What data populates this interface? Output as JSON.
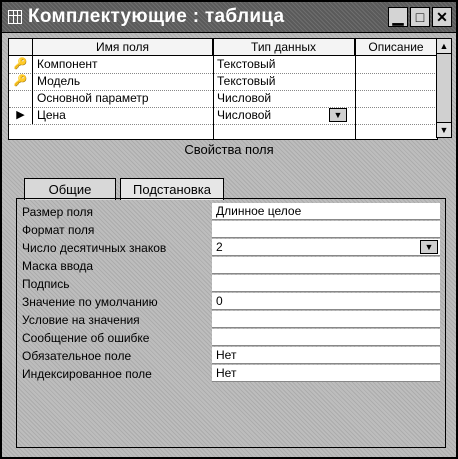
{
  "window": {
    "title": "Комплектующие : таблица"
  },
  "design_grid": {
    "columns": [
      "Имя поля",
      "Тип данных",
      "Описание"
    ],
    "rows": [
      {
        "marker": "key",
        "field": "Компонент",
        "type": "Текстовый"
      },
      {
        "marker": "key",
        "field": "Модель",
        "type": "Текстовый"
      },
      {
        "marker": "",
        "field": "Основной параметр",
        "type": "Числовой"
      },
      {
        "marker": "current",
        "field": "Цена",
        "type": "Числовой"
      }
    ]
  },
  "properties": {
    "title": "Свойства поля",
    "tabs": [
      "Общие",
      "Подстановка"
    ],
    "items": [
      {
        "label": "Размер поля",
        "value": "Длинное целое"
      },
      {
        "label": "Формат поля",
        "value": ""
      },
      {
        "label": "Число десятичных знаков",
        "value": "2"
      },
      {
        "label": "Маска ввода",
        "value": ""
      },
      {
        "label": "Подпись",
        "value": ""
      },
      {
        "label": "Значение по умолчанию",
        "value": "0"
      },
      {
        "label": "Условие на значения",
        "value": ""
      },
      {
        "label": "Сообщение об ошибке",
        "value": ""
      },
      {
        "label": "Обязательное поле",
        "value": "Нет"
      },
      {
        "label": "Индексированное поле",
        "value": "Нет"
      }
    ]
  }
}
